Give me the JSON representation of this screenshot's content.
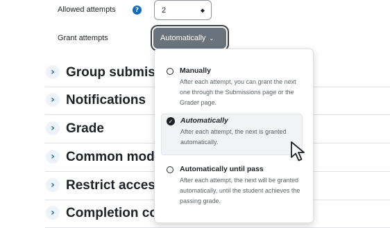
{
  "form": {
    "allowed_attempts_label": "Allowed attempts",
    "allowed_attempts_help_glyph": "?",
    "allowed_attempts_value": "2",
    "grant_attempts_label": "Grant attempts",
    "grant_attempts_value": "Automatically"
  },
  "sections": [
    {
      "label": "Group submis"
    },
    {
      "label": "Notifications"
    },
    {
      "label": "Grade"
    },
    {
      "label": "Common mod"
    },
    {
      "label": "Restrict access"
    },
    {
      "label": "Completion co"
    }
  ],
  "dropdown": {
    "options": [
      {
        "label": "Manually",
        "description": "After each attempt, you can grant the next one through the Submissions page or the Grader page.",
        "selected": false
      },
      {
        "label": "Automatically",
        "description": "After each attempt, the next is granted automatically.",
        "selected": true
      },
      {
        "label": "Automatically until pass",
        "description": "After each attempt, the next will be granted automatically, until the student achieves the passing grade.",
        "selected": false
      }
    ]
  },
  "colors": {
    "accent": "#0f6cbf",
    "button_bg": "#6a737b",
    "text": "#1d2125"
  },
  "icons": [
    "help-icon",
    "select-caret-icon",
    "chevron-down-icon",
    "chevron-right-icon",
    "radio-icon",
    "check-circle-icon",
    "mouse-pointer-icon"
  ]
}
